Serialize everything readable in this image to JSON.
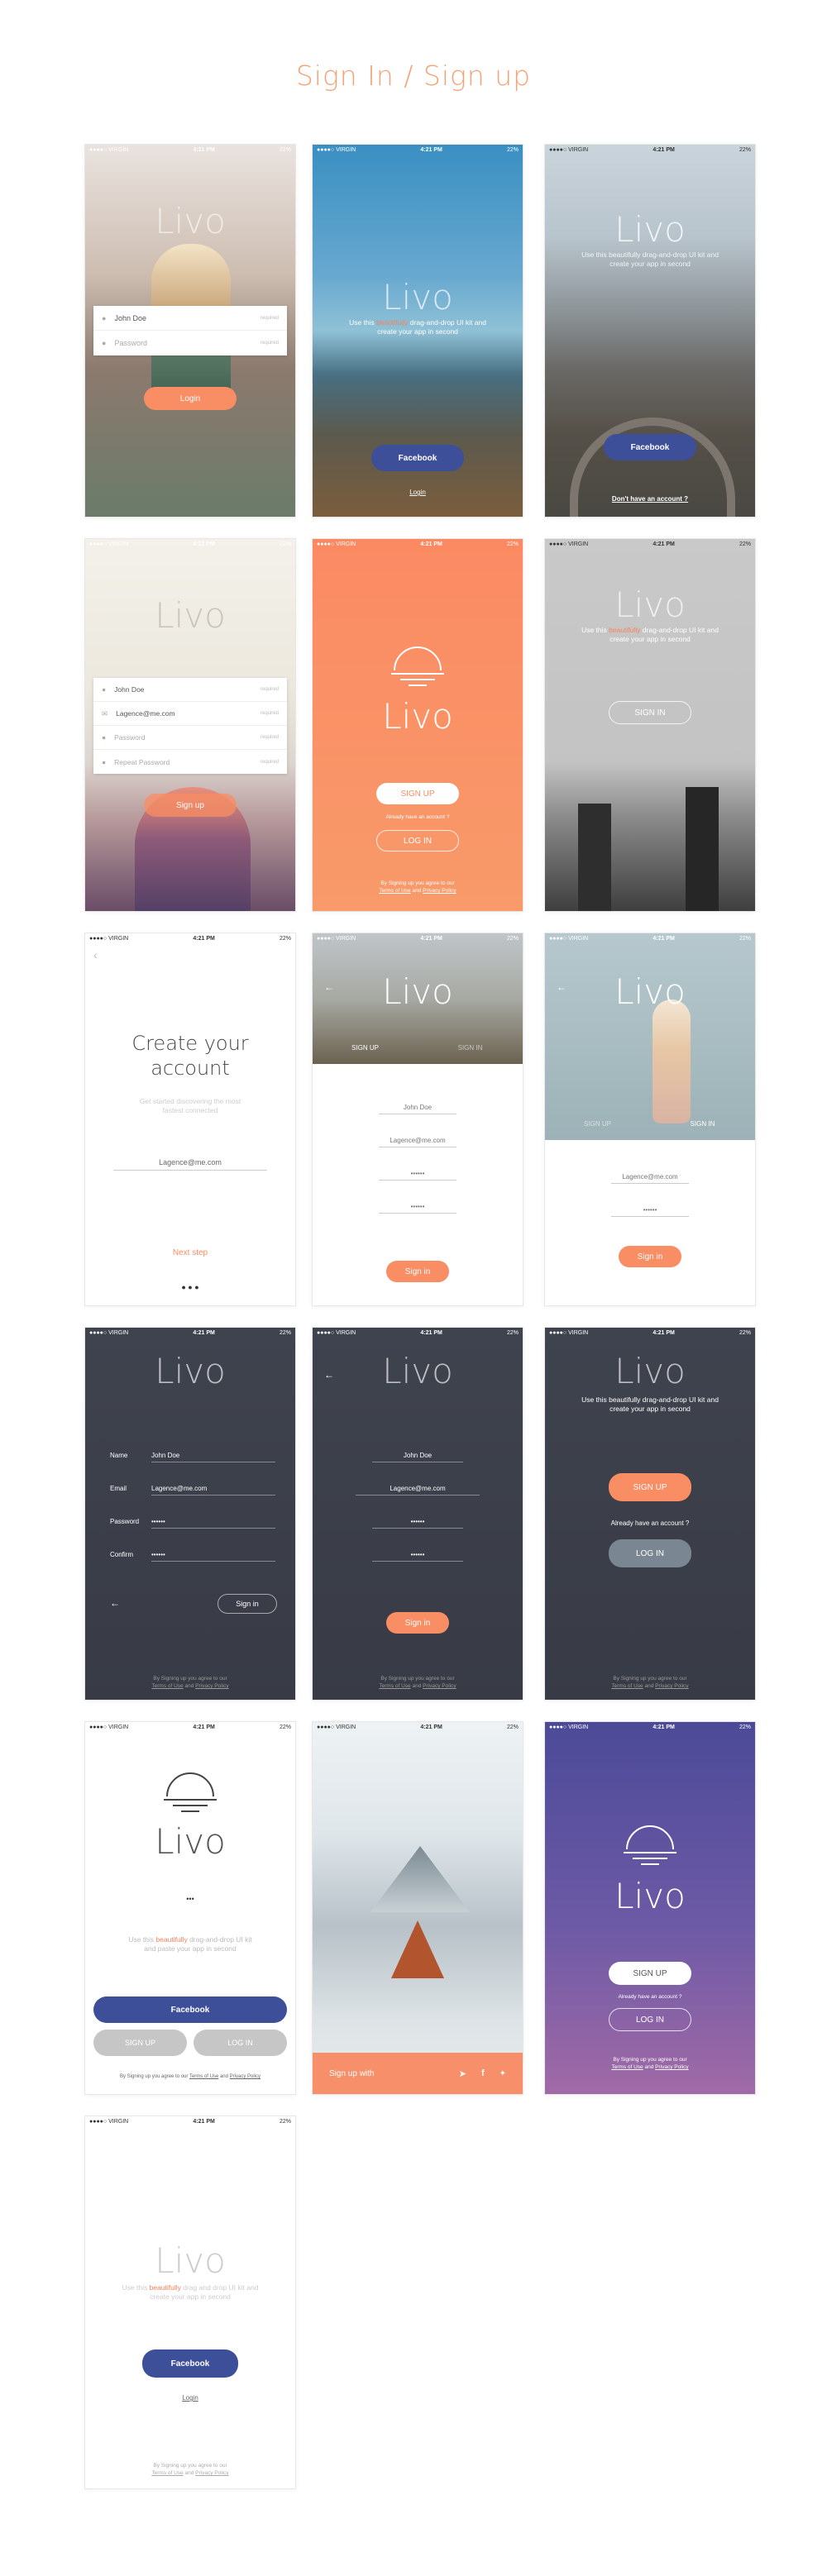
{
  "page": {
    "title": "Sign In / Sign up"
  },
  "status": {
    "carrier": "●●●●○ VIRGIN",
    "time": "4:21 PM",
    "battery": "22%"
  },
  "brand": "Livo",
  "s1": {
    "name": "John Doe",
    "password": "Password",
    "hint": "required",
    "login": "Login"
  },
  "s2": {
    "desc_a": "Use this ",
    "desc_hl": "beautifully",
    "desc_b": " drag-and-drop UI kit and create your app in second",
    "facebook": "Facebook",
    "login": "Login"
  },
  "s3": {
    "desc": "Use this beautifully drag-and-drop UI kit and create your app in second",
    "facebook": "Facebook",
    "no_account": "Don't have an account ?"
  },
  "s4": {
    "name": "John Doe",
    "email": "Lagence@me.com",
    "password": "Password",
    "repeat": "Repeat Password",
    "hint": "required",
    "signup": "Sign up"
  },
  "s5": {
    "signup": "SIGN UP",
    "already": "Already have an account ?",
    "login": "LOG IN",
    "footer_a": "By Signing up you agree to our",
    "terms": "Terms of Use",
    "and": "and",
    "privacy": "Privacy Policy"
  },
  "s6": {
    "desc_a": "Use this ",
    "desc_hl": "beautifully",
    "desc_b": " drag-and-drop UI kit and create your app in second",
    "signin": "SIGN IN"
  },
  "s7": {
    "title_a": "Create your",
    "title_b": "account",
    "desc": "Get started discovering the most fastest connected",
    "email": "Lagence@me.com",
    "next": "Next step"
  },
  "s8": {
    "tab_signup": "SIGN UP",
    "tab_signin": "SIGN IN",
    "name": "John Doe",
    "email": "Lagence@me.com",
    "pass": "••••••",
    "confirm": "••••••",
    "signin": "Sign in"
  },
  "s9": {
    "tab_signup": "SIGN UP",
    "tab_signin": "SIGN IN",
    "email": "Lagence@me.com",
    "pass": "••••••",
    "signin": "Sign in"
  },
  "s10": {
    "name_label": "Name",
    "name": "John Doe",
    "email_label": "Email",
    "email": "Lagence@me.com",
    "pass_label": "Password",
    "pass": "••••••",
    "confirm_label": "Confirm",
    "confirm": "••••••",
    "signin": "Sign in",
    "footer_a": "By Signing up you agree to our",
    "terms": "Terms of Use",
    "and": "and",
    "privacy": "Privacy Policy"
  },
  "s11": {
    "name": "John Doe",
    "email": "Lagence@me.com",
    "pass": "••••••",
    "confirm": "••••••",
    "signin": "Sign in",
    "footer_a": "By Signing up you agree to our",
    "terms": "Terms of Use",
    "and": "and",
    "privacy": "Privacy Policy"
  },
  "s12": {
    "desc": "Use this beautifully drag-and-drop UI kit and create your app in second",
    "signup": "SIGN UP",
    "already": "Already have an account ?",
    "login": "LOG IN",
    "footer_a": "By Signing up you agree to our",
    "terms": "Terms of Use",
    "and": "and",
    "privacy": "Privacy Policy"
  },
  "s13": {
    "dots": "•••",
    "desc_a": "Use this ",
    "desc_hl": "beautifully",
    "desc_b": " drag-and-drop UI kit and paste your app in second",
    "facebook": "Facebook",
    "signup": "SIGN UP",
    "login": "LOG IN",
    "footer_a": "By Signing up you agree to our",
    "terms": "Terms of Use",
    "and": "and",
    "privacy": "Privacy Policy"
  },
  "s14": {
    "signup_with": "Sign up with"
  },
  "s15": {
    "signup": "SIGN UP",
    "already": "Already have an account ?",
    "login": "LOG IN",
    "footer_a": "By Signing up you agree to our",
    "terms": "Terms of Use",
    "and": "and",
    "privacy": "Privacy Policy"
  },
  "s16": {
    "desc_a": "Use this ",
    "desc_hl": "beautifully",
    "desc_b": " drag and drop UI kit and create your app in second",
    "facebook": "Facebook",
    "login": "Login",
    "footer_a": "By Signing up you agree to our",
    "terms": "Terms of Use",
    "and": "and",
    "privacy": "Privacy Policy"
  },
  "colors": {
    "accent": "#f98d63",
    "navy": "#3d4f99",
    "dark": "#3b3f4c",
    "title": "#f6a175"
  },
  "icons": {
    "back": "arrow-left-icon",
    "sun": "sunset-logo-icon",
    "user": "user-icon",
    "mail": "mail-icon",
    "lock": "lock-icon",
    "send": "paper-plane-icon",
    "facebook": "facebook-icon",
    "twitter": "twitter-icon"
  }
}
